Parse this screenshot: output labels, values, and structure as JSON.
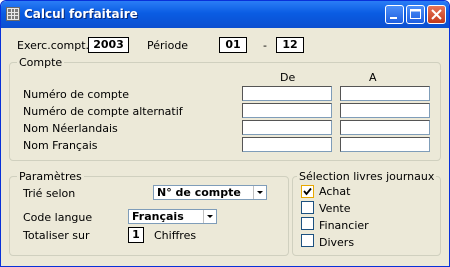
{
  "window": {
    "title": "Calcul forfaitaire",
    "buttons": [
      "minimize",
      "maximize",
      "close"
    ]
  },
  "header": {
    "exerc_label": "Exerc.compt.",
    "exerc_value": "2003",
    "periode_label": "Période",
    "periode_from": "01",
    "periode_sep": "-",
    "periode_to": "12"
  },
  "compte": {
    "legend": "Compte",
    "col_de": "De",
    "col_a": "A",
    "rows": [
      {
        "label": "Numéro de compte",
        "de": "",
        "a": ""
      },
      {
        "label": "Numéro de compte alternatif",
        "de": "",
        "a": ""
      },
      {
        "label": "Nom Néerlandais",
        "de": "",
        "a": ""
      },
      {
        "label": "Nom Français",
        "de": "",
        "a": ""
      }
    ]
  },
  "parametres": {
    "legend": "Paramètres",
    "trie_label": "Trié selon",
    "trie_value": "N° de compte",
    "langue_label": "Code langue",
    "langue_value": "Français",
    "totaliser_label": "Totaliser sur",
    "totaliser_value": "1",
    "chiffres_label": "Chiffres"
  },
  "selection": {
    "legend": "Sélection livres journaux",
    "items": [
      {
        "label": "Achat",
        "checked": true
      },
      {
        "label": "Vente",
        "checked": false
      },
      {
        "label": "Financier",
        "checked": false
      },
      {
        "label": "Divers",
        "checked": false
      }
    ]
  }
}
